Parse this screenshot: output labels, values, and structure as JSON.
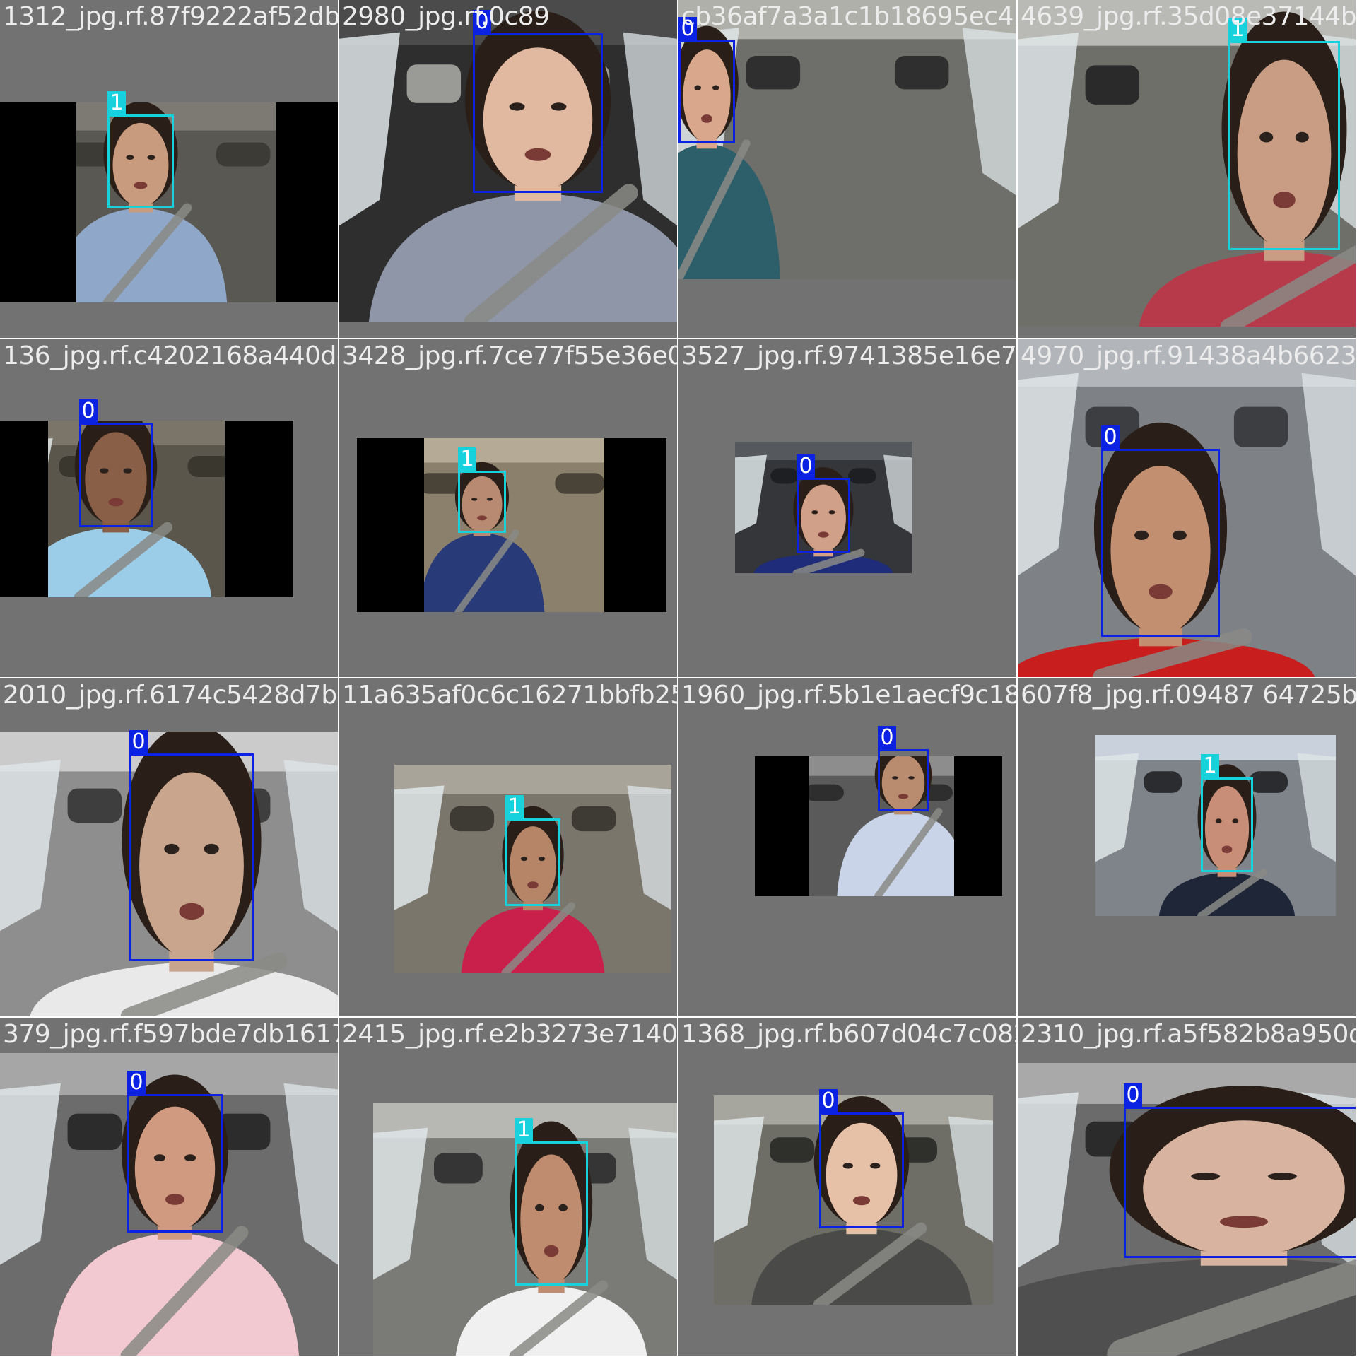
{
  "grid": {
    "columns": 4,
    "rows": 4,
    "tile_background": "#727272",
    "class_colors": {
      "0": "#0b22e3",
      "1": "#17d2dc"
    }
  },
  "tiles": [
    {
      "filename": "1312_jpg.rf.87f9222af52db12481405c3c0c8428544e4f1",
      "scene": "cabin",
      "letterbox": "pillar",
      "boxes": [
        {
          "cls": "1"
        }
      ]
    },
    {
      "filename": "2980_jpg.rf.0c89",
      "scene": "cabin",
      "letterbox": "none",
      "boxes": [
        {
          "cls": "0"
        }
      ]
    },
    {
      "filename": "cb36af7a3a1c1b18695ec4b",
      "scene": "cabin-two",
      "letterbox": "bottom",
      "boxes": [
        {
          "cls": "0"
        }
      ]
    },
    {
      "filename": "4639_jpg.rf.35d08e37144b1",
      "scene": "cabin",
      "letterbox": "none",
      "boxes": [
        {
          "cls": "1"
        }
      ]
    },
    {
      "filename": "136_jpg.rf.c4202168a440de3428e7fe77f55e36e0863116",
      "scene": "cabin",
      "letterbox": "pillar",
      "boxes": [
        {
          "cls": "0"
        }
      ]
    },
    {
      "filename": "3428_jpg.rf.7ce77f55e36e08631",
      "scene": "cabin",
      "letterbox": "pillar",
      "boxes": [
        {
          "cls": "1"
        }
      ]
    },
    {
      "filename": "3527_jpg.rf.9741385e16e7a0942",
      "scene": "cabin",
      "letterbox": "inset",
      "boxes": [
        {
          "cls": "0"
        }
      ]
    },
    {
      "filename": "4970_jpg.rf.91438a4b66235dc4",
      "scene": "cabin",
      "letterbox": "none",
      "boxes": [
        {
          "cls": "0"
        }
      ]
    },
    {
      "filename": "2010_jpg.rf.6174c5428d7b1e1a635af0c6c16271bbfb2560e7940",
      "scene": "cabin",
      "letterbox": "none",
      "boxes": [
        {
          "cls": "0"
        }
      ]
    },
    {
      "filename": "11a635af0c6c16271bbfb2560e7940",
      "scene": "cabin",
      "letterbox": "inset",
      "boxes": [
        {
          "cls": "1"
        }
      ]
    },
    {
      "filename": "1960_jpg.rf.5b1e1aecf9c183e1697f8",
      "scene": "cabin",
      "letterbox": "inset-pillar",
      "boxes": [
        {
          "cls": "0"
        }
      ]
    },
    {
      "filename": "607f8_jpg.rf.09487 64725b5598",
      "scene": "cabin",
      "letterbox": "inset",
      "boxes": [
        {
          "cls": "1"
        }
      ]
    },
    {
      "filename": "379_jpg.rf.f597bde7db16172a415_jpg.rf.e2b3273e7140ee3",
      "scene": "cabin",
      "letterbox": "bottom",
      "boxes": [
        {
          "cls": "0"
        }
      ]
    },
    {
      "filename": "2415_jpg.rf.e2b3273e7140ee30368",
      "scene": "cabin",
      "letterbox": "inset",
      "boxes": [
        {
          "cls": "1"
        }
      ]
    },
    {
      "filename": "1368_jpg.rf.b607d04c7c082fc4",
      "scene": "cabin",
      "letterbox": "inset",
      "boxes": [
        {
          "cls": "0"
        }
      ]
    },
    {
      "filename": "2310_jpg.rf.a5f582b8a950d12",
      "scene": "cabin",
      "letterbox": "none",
      "boxes": [
        {
          "cls": "0"
        }
      ]
    }
  ]
}
